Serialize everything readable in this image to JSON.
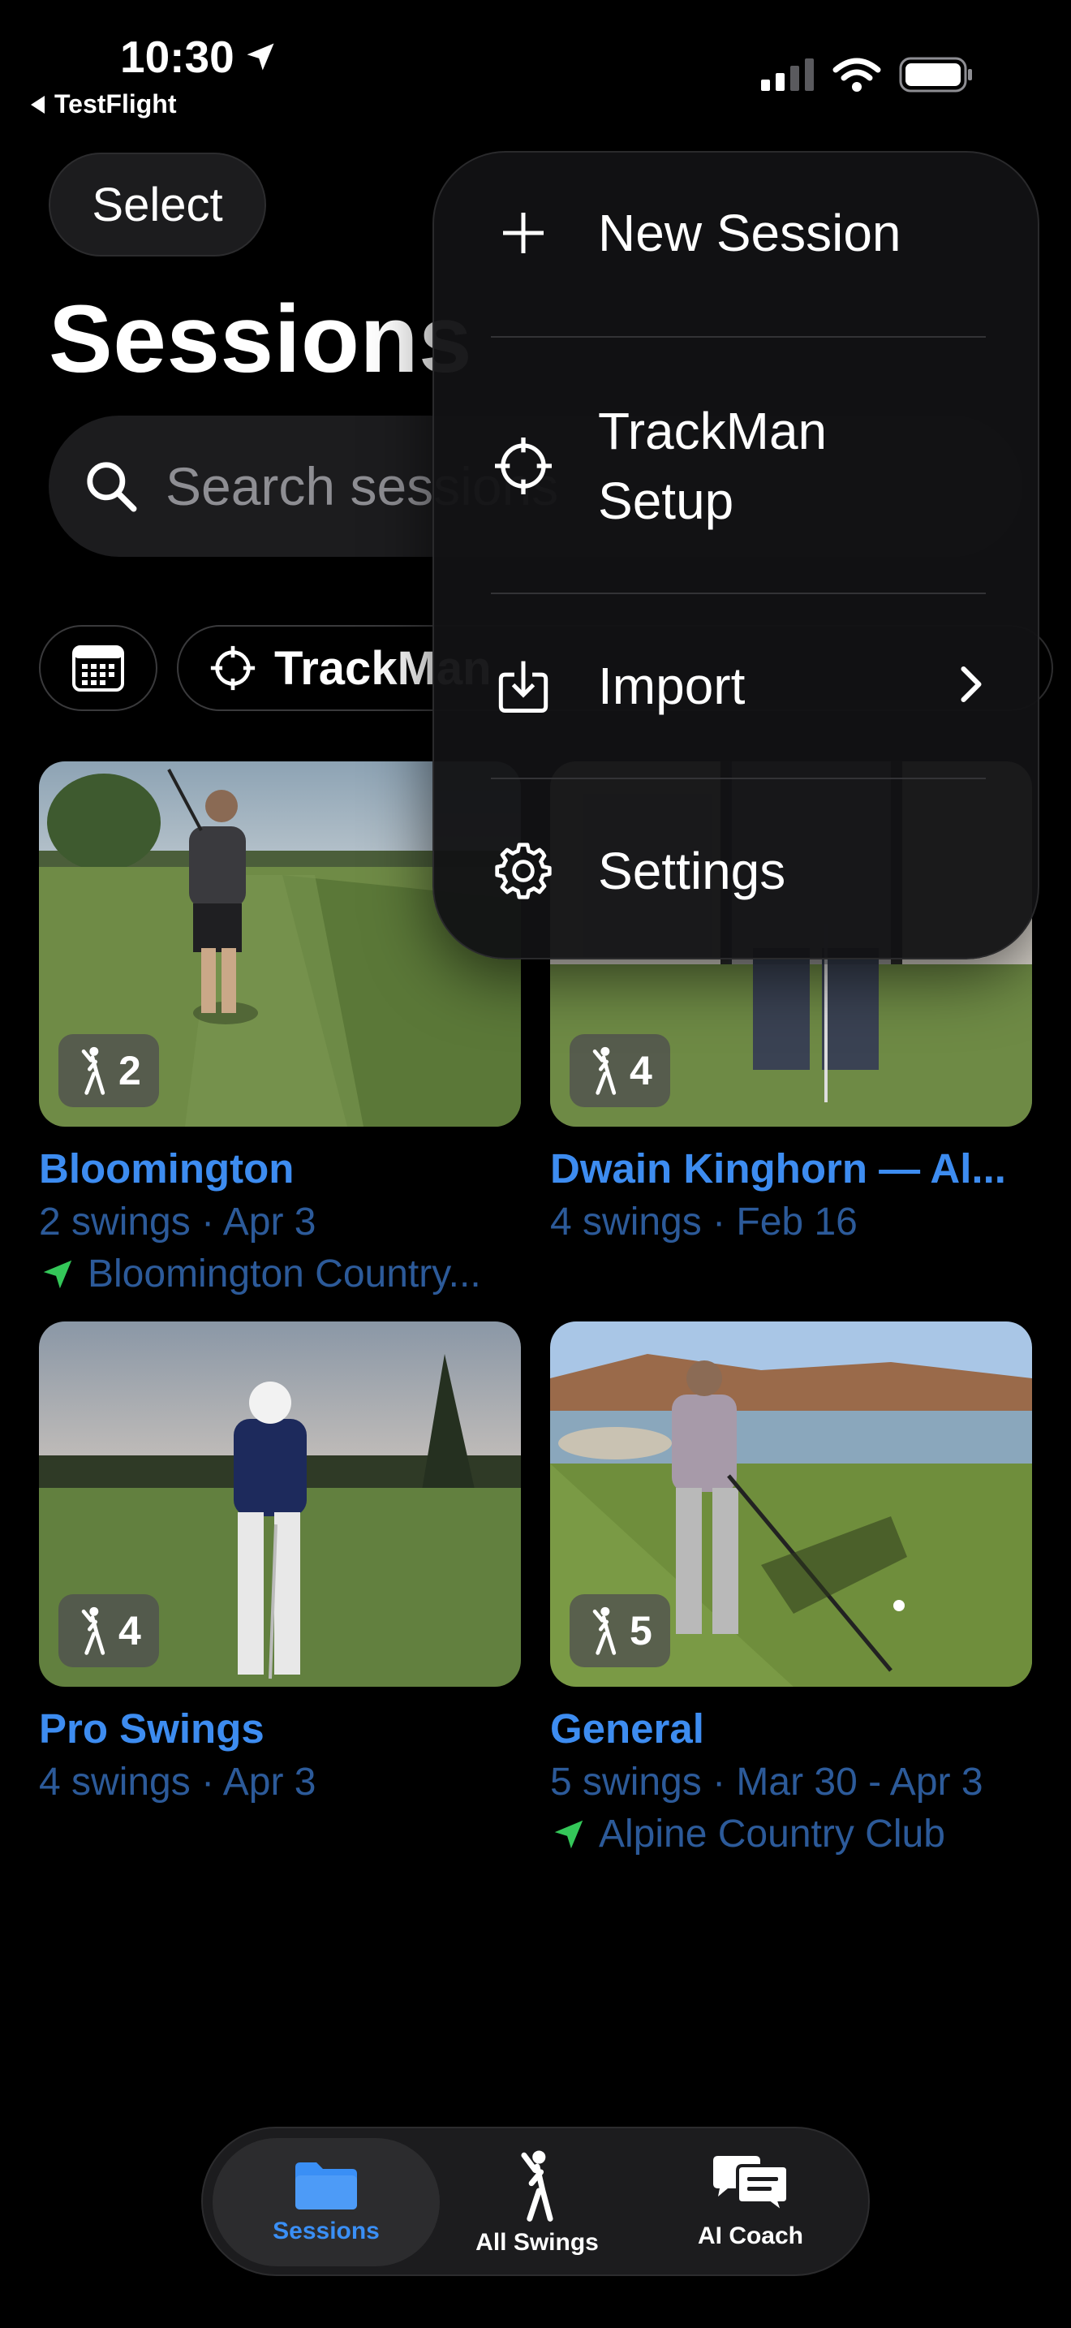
{
  "status_bar": {
    "time": "10:30",
    "back_app": "TestFlight"
  },
  "header": {
    "select_label": "Select",
    "title": "Sessions",
    "search_placeholder": "Search sessions"
  },
  "filters": {
    "trackman_label": "TrackMan"
  },
  "sessions": [
    {
      "title": "Bloomington",
      "meta": "2 swings · Apr 3",
      "location": "Bloomington Country...",
      "swing_count": "2"
    },
    {
      "title": "Dwain Kinghorn — Al...",
      "meta": "4 swings · Feb 16",
      "location": "",
      "swing_count": "4"
    },
    {
      "title": "Pro Swings",
      "meta": "4 swings · Apr 3",
      "location": "",
      "swing_count": "4"
    },
    {
      "title": "General",
      "meta": "5 swings · Mar 30 - Apr 3",
      "location": "Alpine Country Club",
      "swing_count": "5"
    }
  ],
  "tabbar": {
    "tabs": [
      {
        "label": "Sessions",
        "icon": "folder-icon",
        "active": true
      },
      {
        "label": "All Swings",
        "icon": "golfer-icon",
        "active": false
      },
      {
        "label": "AI Coach",
        "icon": "chat-bubbles-icon",
        "active": false
      }
    ]
  },
  "menu": {
    "items": [
      {
        "label": "New Session",
        "icon": "plus-icon"
      },
      {
        "label": "TrackMan\nSetup",
        "icon": "crosshair-icon"
      },
      {
        "label": "Import",
        "icon": "import-tray-icon",
        "has_submenu": true
      },
      {
        "label": "Settings",
        "icon": "gear-icon"
      }
    ]
  },
  "colors": {
    "accent": "#3d8cf0",
    "location_arrow": "#34c759",
    "background": "#000000"
  }
}
